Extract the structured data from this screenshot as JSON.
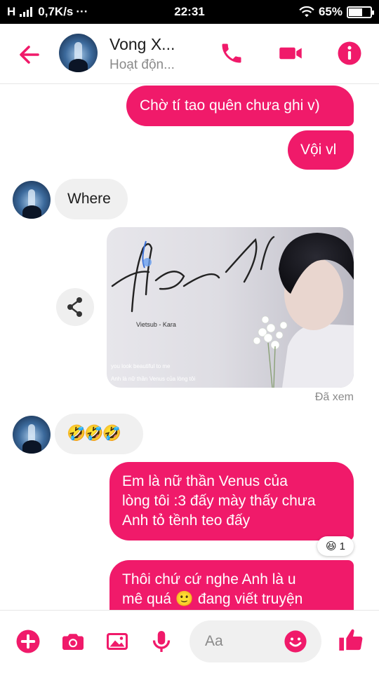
{
  "status_bar": {
    "network": "H",
    "speed": "0,7K/s",
    "dots": "···",
    "time": "22:31",
    "battery": "65%",
    "battery_level": 0.65
  },
  "header": {
    "contact_name": "Vong X...",
    "contact_status": "Hoạt độn...",
    "icons": [
      "back-arrow-icon",
      "phone-icon",
      "video-camera-icon",
      "info-icon"
    ],
    "accent": "#f01a6a"
  },
  "messages": {
    "m1": "Chờ tí tao quên chưa ghi v)",
    "m2": "Vội vl",
    "m3": "Where",
    "photo_title": "Beautiful",
    "photo_sub": "Vietsub - Kara",
    "photo_caption1": "you look beautiful to me",
    "photo_caption2": "Anh là nữ thần Venus của lòng tôi",
    "seen": "Đã xem",
    "m5_emoji": "🤣🤣🤣",
    "m6_l1": "Em là nữ thần Venus của",
    "m6_l2": "lòng tôi :3 đấy mày thấy chưa",
    "m6_l3": "Anh tỏ tềnh teo đấy",
    "reaction_emoji": "😆",
    "reaction_count": "1",
    "m7_l1": "Thôi chứ cứ nghe Anh là u",
    "m7_l2a": "mê quá",
    "m7_emoji": "🙂",
    "m7_l2b": "đang viết truyện"
  },
  "composer": {
    "placeholder": "Aa",
    "icons": [
      "plus-icon",
      "camera-icon",
      "image-icon",
      "microphone-icon",
      "emoji-icon",
      "thumbs-up-icon"
    ]
  },
  "colors": {
    "accent": "#f01a6a",
    "incoming_bubble": "#f0f0f0"
  }
}
